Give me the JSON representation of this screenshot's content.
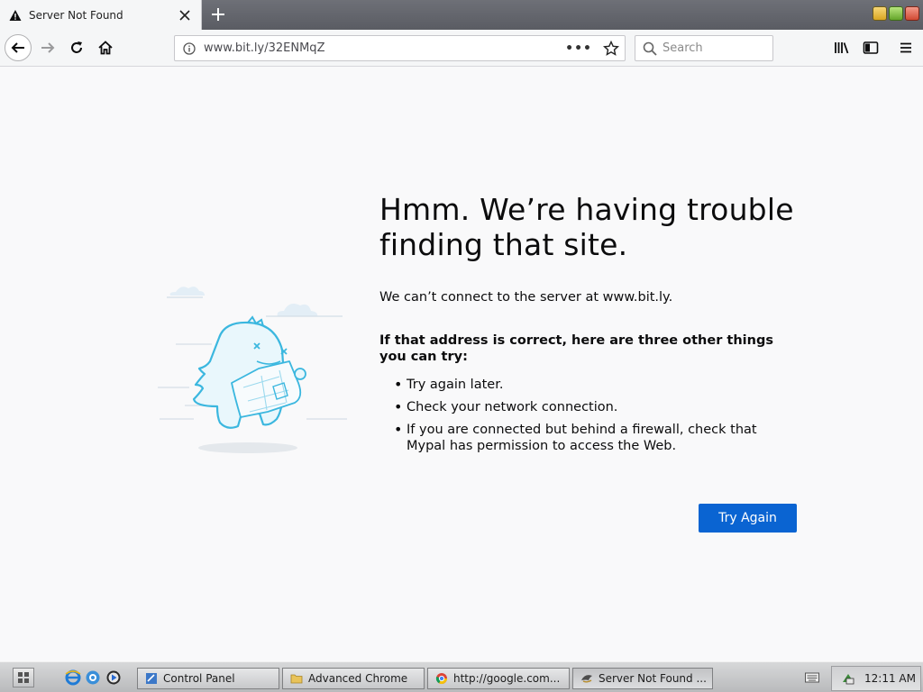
{
  "browser": {
    "tab": {
      "title": "Server Not Found",
      "warning_icon": "warning-icon",
      "close_icon": "close-icon"
    },
    "newtab_icon": "plus-icon",
    "toolbar": {
      "url": "www.bit.ly/32ENMqZ",
      "page_actions": "•••",
      "search_placeholder": "Search"
    }
  },
  "error_page": {
    "heading": "Hmm. We’re having trouble finding that site.",
    "description": "We can’t connect to the server at www.bit.ly.",
    "suggestions_title": "If that address is correct, here are three other things you can try:",
    "suggestions": [
      "Try again later.",
      "Check your network connection.",
      "If you are connected but behind a firewall, check that Mypal has permission to access the Web."
    ],
    "try_again_label": "Try Again",
    "accent_color": "#0a64d2"
  },
  "taskbar": {
    "tasks": [
      {
        "label": "Control Panel",
        "icon": "control-panel-icon"
      },
      {
        "label": "Advanced Chrome",
        "icon": "folder-icon"
      },
      {
        "label": "http://google.com...",
        "icon": "chrome-icon"
      },
      {
        "label": "Server Not Found ...",
        "icon": "mypal-icon"
      }
    ],
    "clock": "12:11 AM"
  }
}
